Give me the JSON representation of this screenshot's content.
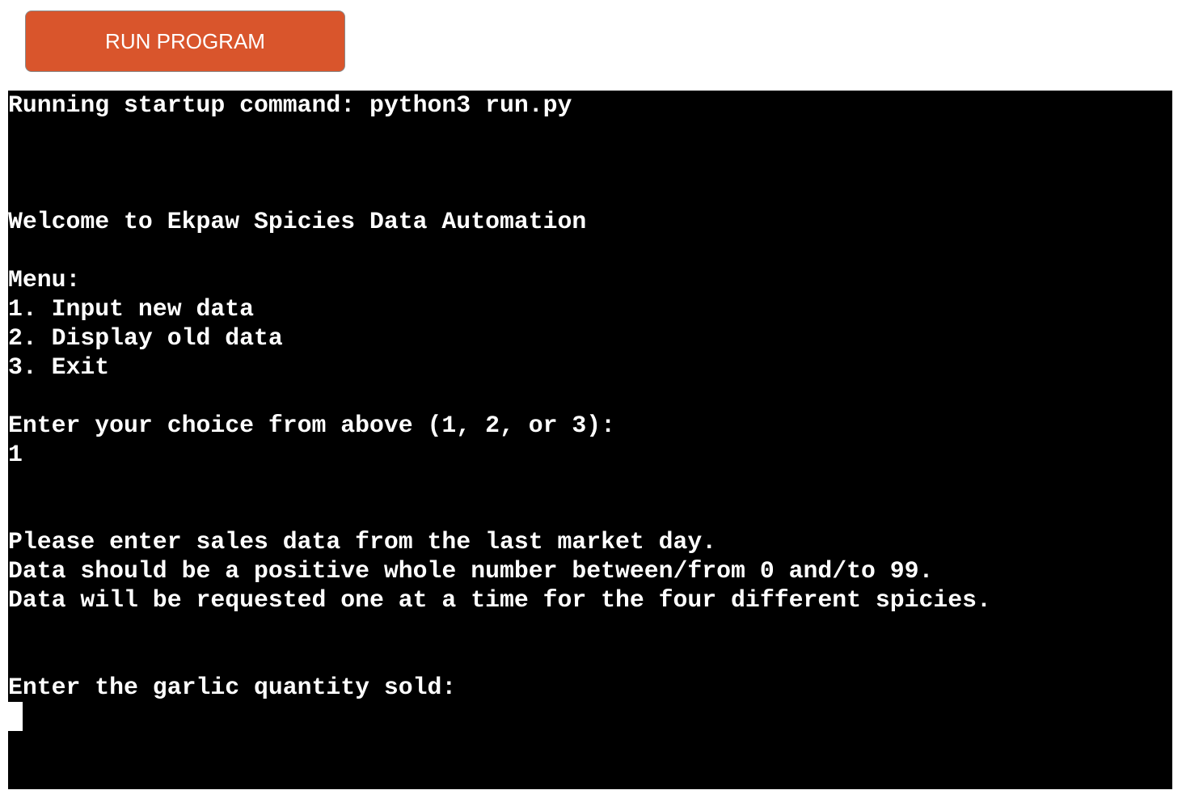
{
  "toolbar": {
    "run_label": "RUN PROGRAM"
  },
  "terminal": {
    "lines": [
      "Running startup command: python3 run.py",
      "",
      "",
      "",
      "Welcome to Ekpaw Spicies Data Automation",
      "",
      "Menu:",
      "1. Input new data",
      "2. Display old data",
      "3. Exit",
      "",
      "Enter your choice from above (1, 2, or 3):",
      "1",
      "",
      "",
      "Please enter sales data from the last market day.",
      "Data should be a positive whole number between/from 0 and/to 99.",
      "Data will be requested one at a time for the four different spicies.",
      "",
      "",
      "Enter the garlic quantity sold:"
    ]
  },
  "colors": {
    "button_bg": "#d9552c",
    "terminal_bg": "#000000",
    "terminal_fg": "#ffffff"
  }
}
